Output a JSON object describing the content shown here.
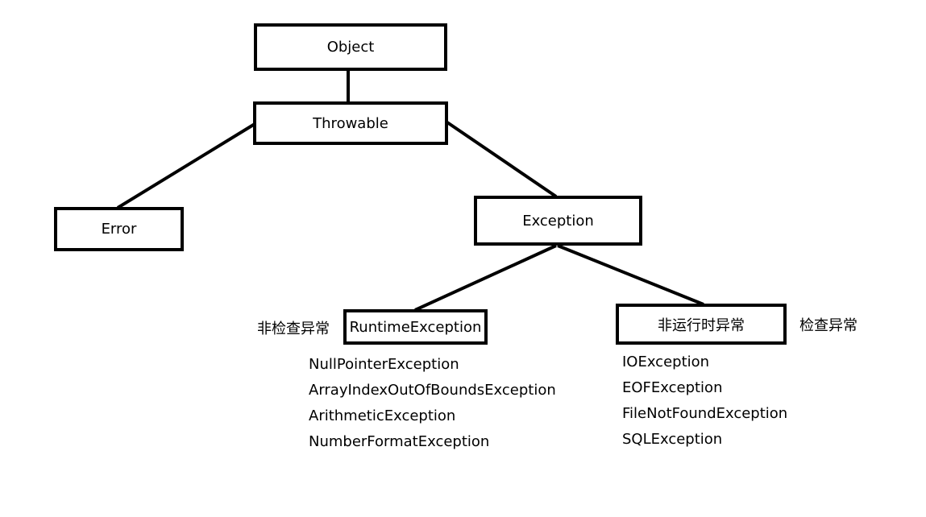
{
  "nodes": {
    "object": "Object",
    "throwable": "Throwable",
    "error": "Error",
    "exception": "Exception",
    "runtime_exception": "RuntimeException",
    "non_runtime_exception": "非运行时异常"
  },
  "labels": {
    "unchecked": "非检查异常",
    "checked": "检查异常"
  },
  "runtime_exceptions": [
    "NullPointerException",
    "ArrayIndexOutOfBoundsException",
    "ArithmeticException",
    "NumberFormatException"
  ],
  "checked_exceptions": [
    "IOException",
    "EOFException",
    "FileNotFoundException",
    "SQLException"
  ]
}
